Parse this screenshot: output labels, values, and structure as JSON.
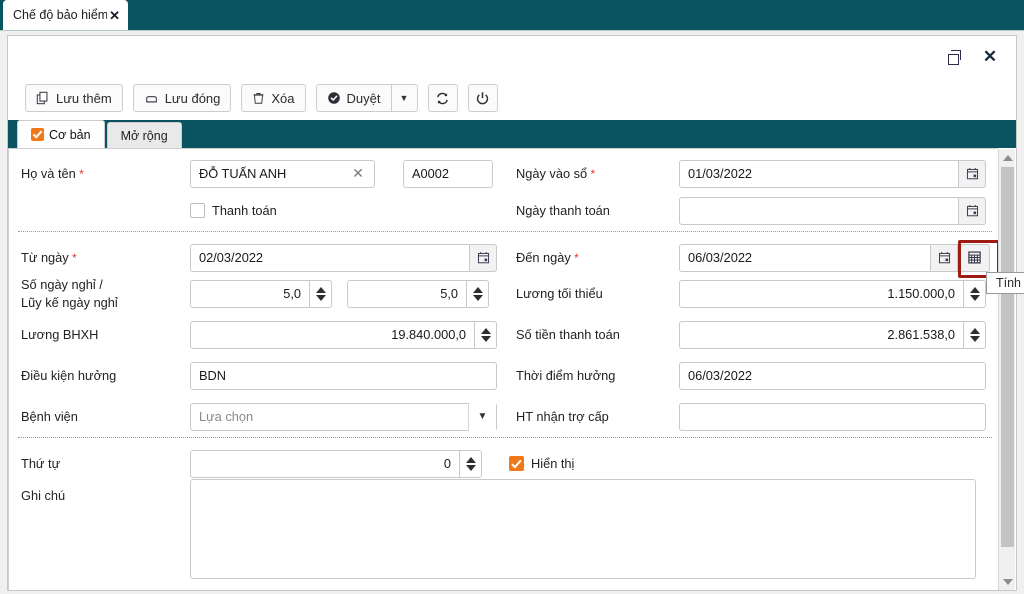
{
  "tab_bar": {
    "document_tab_title": "Chế độ bảo hiểm",
    "close_label": "✕"
  },
  "window": {
    "restore_icon": "restore-icon",
    "close_icon": "close-icon",
    "close_label": "✕"
  },
  "toolbar": {
    "buttons": [
      {
        "label": "Lưu thêm",
        "icon": "copy-icon"
      },
      {
        "label": "Lưu đóng",
        "icon": "save-icon"
      },
      {
        "label": "Xóa",
        "icon": "trash-icon"
      },
      {
        "label": "Duyệt",
        "icon": "check-circle-icon"
      }
    ],
    "dropdown_arrow": "▼",
    "refresh_icon": "refresh-icon",
    "power_icon": "power-icon"
  },
  "tabs": [
    {
      "label": "Cơ bản",
      "active": true,
      "checked": true
    },
    {
      "label": "Mở rộng",
      "active": false,
      "checked": false
    }
  ],
  "form": {
    "full_name": {
      "label": "Họ và tên",
      "required": true,
      "value": "ĐỖ TUẤN ANH",
      "clear_icon": "✕",
      "code_value": "A0002"
    },
    "entry_date": {
      "label": "Ngày vào sổ",
      "required": true,
      "value": "01/03/2022",
      "icon": "calendar-icon"
    },
    "payment_checkbox": {
      "label": "Thanh toán",
      "checked": false
    },
    "payment_date": {
      "label": "Ngày thanh toán",
      "required": false,
      "value": "",
      "icon": "calendar-icon"
    },
    "from_date": {
      "label": "Từ ngày",
      "required": true,
      "value": "02/03/2022",
      "icon": "calendar-icon"
    },
    "to_date": {
      "label": "Đến ngày",
      "required": true,
      "value": "06/03/2022",
      "icon": "calendar-icon",
      "calc_icon": "calculator-icon",
      "calc_tooltip": "Tính",
      "highlight_color": "#9e1b14"
    },
    "leave_days": {
      "label_line1": "Số ngày nghỉ /",
      "label_line2": "Lũy kế ngày nghỉ",
      "value_1": "5,0",
      "value_2": "5,0"
    },
    "min_salary": {
      "label": "Lương tối thiểu",
      "value": "1.150.000,0"
    },
    "insurance_salary": {
      "label": "Lương BHXH",
      "value": "19.840.000,0"
    },
    "payment_amount": {
      "label": "Số tiền thanh toán",
      "value": "2.861.538,0"
    },
    "condition": {
      "label": "Điều kiện hưởng",
      "value": "BDN"
    },
    "benefit_time": {
      "label": "Thời điểm hưởng",
      "value": "06/03/2022"
    },
    "hospital": {
      "label": "Bệnh viện",
      "placeholder": "Lựa chọn",
      "value": "",
      "arrow": "▼"
    },
    "subsidy_form": {
      "label": "HT nhận trợ cấp",
      "value": ""
    },
    "order": {
      "label": "Thứ tự",
      "value": "0"
    },
    "display_checkbox": {
      "label": "Hiển thị",
      "checked": true
    },
    "note": {
      "label": "Ghi chú",
      "value": ""
    }
  },
  "scrollbar": {
    "up_icon": "scroll-up-icon",
    "down_icon": "scroll-down-icon"
  },
  "colors": {
    "teal": "#0a5360",
    "accent_orange": "#f07818",
    "required_red": "#e03a2f",
    "highlight_red": "#9e1b14"
  }
}
